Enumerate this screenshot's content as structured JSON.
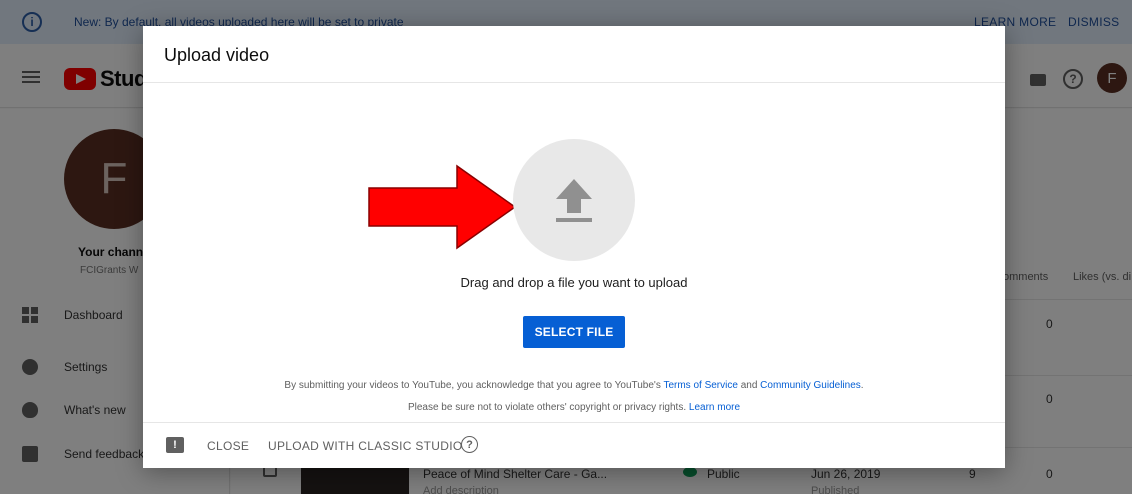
{
  "banner": {
    "message": "New: By default, all videos uploaded here will be set to private",
    "learn_more": "LEARN MORE",
    "dismiss": "DISMISS"
  },
  "topbar": {
    "logo_text": "Studio",
    "avatar_initial": "F"
  },
  "sidebar": {
    "avatar_initial": "F",
    "channel_label": "Your channel",
    "channel_name": "FCIGrants W",
    "items": [
      {
        "label": "Dashboard",
        "icon": "dashboard-icon"
      },
      {
        "label": "Settings",
        "icon": "gear-icon"
      },
      {
        "label": "What's new",
        "icon": "shield-icon"
      },
      {
        "label": "Send feedback",
        "icon": "feedback-icon"
      }
    ]
  },
  "table": {
    "headers": [
      "omments",
      "Likes (vs. di"
    ],
    "values": [
      "0",
      "0",
      "0"
    ],
    "video": {
      "title": "Peace of Mind Shelter Care - Ga...",
      "description": "Add description",
      "visibility": "Public",
      "date": "Jun 26, 2019",
      "status": "Published",
      "views": "9"
    }
  },
  "dialog": {
    "title": "Upload video",
    "drag_text": "Drag and drop a file you want to upload",
    "select_button": "SELECT FILE",
    "terms_prefix": "By submitting your videos to YouTube, you acknowledge that you agree to YouTube's ",
    "terms_link": "Terms of Service",
    "terms_and": " and ",
    "guidelines_link": "Community Guidelines",
    "terms_suffix": ".",
    "copyright_text": "Please be sure not to violate others' copyright or privacy rights. ",
    "learn_more_link": "Learn more",
    "close_button": "CLOSE",
    "classic_button": "UPLOAD WITH CLASSIC STUDIO"
  },
  "colors": {
    "accent": "#065fd4",
    "arrow": "#ff0000",
    "logo": "#ff0000"
  }
}
